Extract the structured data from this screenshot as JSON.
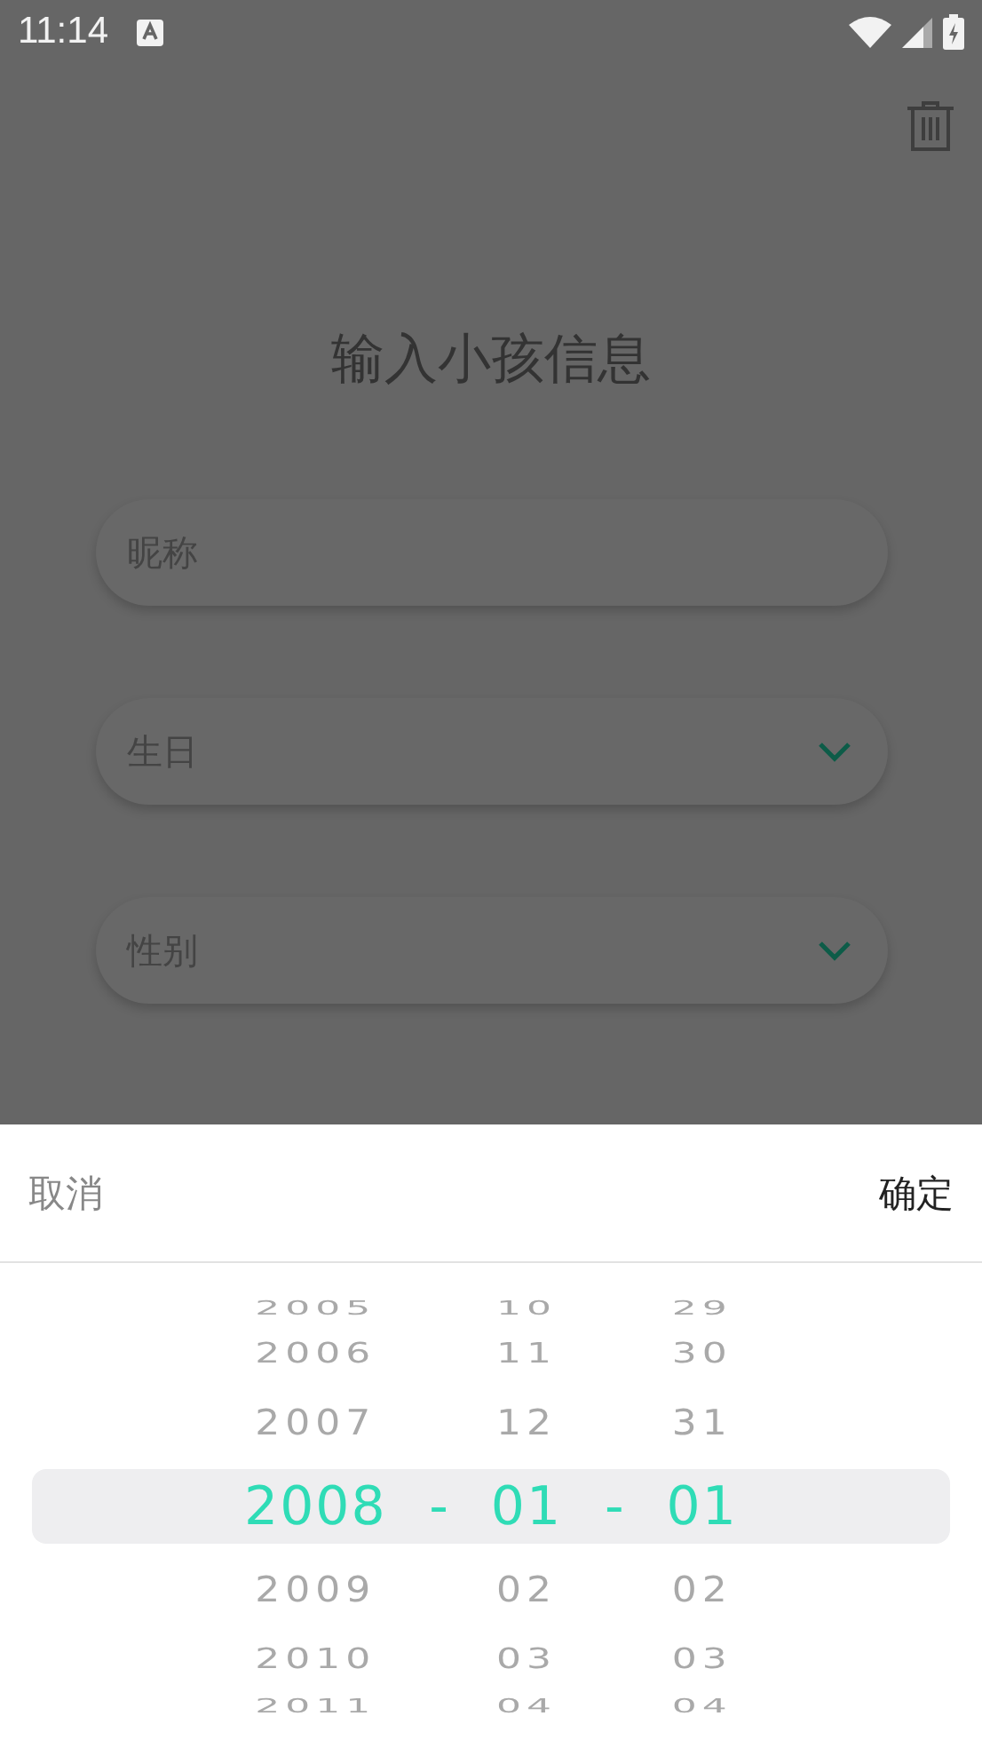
{
  "status_bar": {
    "time": "11:14"
  },
  "page": {
    "title": "输入小孩信息"
  },
  "fields": [
    {
      "kind": "text",
      "placeholder": "昵称"
    },
    {
      "kind": "dropdown",
      "placeholder": "生日"
    },
    {
      "kind": "dropdown",
      "placeholder": "性别"
    }
  ],
  "date_picker": {
    "cancel": "取消",
    "confirm": "确定",
    "separators": [
      "-",
      "-"
    ],
    "columns": [
      {
        "items": [
          {
            "label": "2005",
            "selected": false
          },
          {
            "label": "2006",
            "selected": false
          },
          {
            "label": "2007",
            "selected": false
          },
          {
            "label": "2008",
            "selected": true
          },
          {
            "label": "2009",
            "selected": false
          },
          {
            "label": "2010",
            "selected": false
          },
          {
            "label": "2011",
            "selected": false
          }
        ]
      },
      {
        "items": [
          {
            "label": "10",
            "selected": false
          },
          {
            "label": "11",
            "selected": false
          },
          {
            "label": "12",
            "selected": false
          },
          {
            "label": "01",
            "selected": true
          },
          {
            "label": "02",
            "selected": false
          },
          {
            "label": "03",
            "selected": false
          },
          {
            "label": "04",
            "selected": false
          }
        ]
      },
      {
        "items": [
          {
            "label": "29",
            "selected": false
          },
          {
            "label": "30",
            "selected": false
          },
          {
            "label": "31",
            "selected": false
          },
          {
            "label": "01",
            "selected": true
          },
          {
            "label": "02",
            "selected": false
          },
          {
            "label": "03",
            "selected": false
          },
          {
            "label": "04",
            "selected": false
          }
        ]
      }
    ]
  }
}
